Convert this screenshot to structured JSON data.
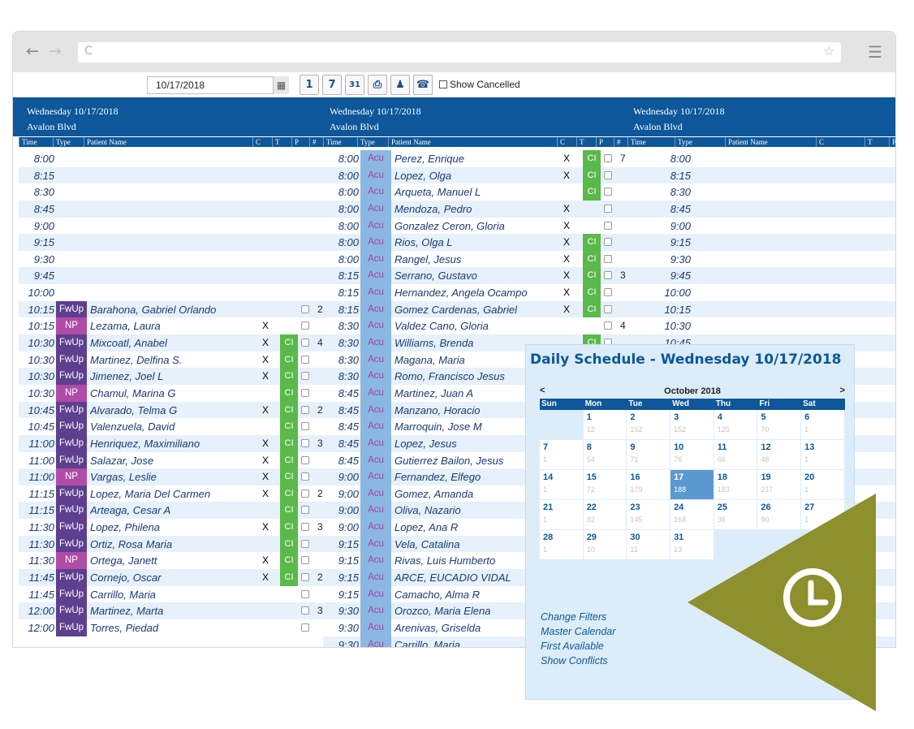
{
  "browser": {
    "back_icon": "←",
    "forward_icon": "→",
    "reload_icon": "C",
    "star_icon": "☆",
    "menu_icon": "☰"
  },
  "toolbar": {
    "date_value": "10/17/2018",
    "calendar_icon": "▦",
    "buttons": [
      {
        "name": "day-view-icon",
        "glyph": "1"
      },
      {
        "name": "week-view-icon",
        "glyph": "7"
      },
      {
        "name": "month-view-icon",
        "glyph": "31"
      },
      {
        "name": "print-icon",
        "glyph": "⎙"
      },
      {
        "name": "person-icon",
        "glyph": "♟"
      },
      {
        "name": "phone-icon",
        "glyph": "☎"
      }
    ],
    "show_cancelled_label": "Show Cancelled"
  },
  "columns": [
    {
      "day": "Wednesday 10/17/2018",
      "location": "Avalon Blvd",
      "headers": [
        "Time",
        "Type",
        "Patient Name",
        "C",
        "T",
        "P",
        "#"
      ]
    },
    {
      "day": "Wednesday 10/17/2018",
      "location": "Avalon Blvd",
      "headers": [
        "Time",
        "Type",
        "Patient Name",
        "C",
        "T",
        "P",
        "#"
      ]
    },
    {
      "day": "Wednesday 10/17/2018",
      "location": "Avalon Blvd",
      "headers": [
        "Time",
        "Type",
        "Patient Name",
        "C",
        "T",
        "P"
      ]
    }
  ],
  "schedule1": [
    {
      "time": "8:00",
      "type": "",
      "name": "",
      "c": "",
      "t": "",
      "p": false,
      "num": ""
    },
    {
      "time": "8:15",
      "type": "",
      "name": "",
      "c": "",
      "t": "",
      "p": false,
      "num": ""
    },
    {
      "time": "8:30",
      "type": "",
      "name": "",
      "c": "",
      "t": "",
      "p": false,
      "num": ""
    },
    {
      "time": "8:45",
      "type": "",
      "name": "",
      "c": "",
      "t": "",
      "p": false,
      "num": ""
    },
    {
      "time": "9:00",
      "type": "",
      "name": "",
      "c": "",
      "t": "",
      "p": false,
      "num": ""
    },
    {
      "time": "9:15",
      "type": "",
      "name": "",
      "c": "",
      "t": "",
      "p": false,
      "num": ""
    },
    {
      "time": "9:30",
      "type": "",
      "name": "",
      "c": "",
      "t": "",
      "p": false,
      "num": ""
    },
    {
      "time": "9:45",
      "type": "",
      "name": "",
      "c": "",
      "t": "",
      "p": false,
      "num": ""
    },
    {
      "time": "10:00",
      "type": "",
      "name": "",
      "c": "",
      "t": "",
      "p": false,
      "num": ""
    },
    {
      "time": "10:15",
      "type": "FwUp",
      "name": "Barahona, Gabriel Orlando",
      "c": "",
      "t": "",
      "p": true,
      "num": "2"
    },
    {
      "time": "10:15",
      "type": "NP",
      "name": "Lezama, Laura",
      "c": "X",
      "t": "",
      "p": true,
      "num": ""
    },
    {
      "time": "10:30",
      "type": "FwUp",
      "name": "Mixcoatl, Anabel",
      "c": "X",
      "t": "CI",
      "p": true,
      "num": "4"
    },
    {
      "time": "10:30",
      "type": "FwUp",
      "name": "Martinez, Delfina S.",
      "c": "X",
      "t": "CI",
      "p": true,
      "num": ""
    },
    {
      "time": "10:30",
      "type": "FwUp",
      "name": "Jimenez, Joel L",
      "c": "X",
      "t": "CI",
      "p": true,
      "num": ""
    },
    {
      "time": "10:30",
      "type": "NP",
      "name": "Chamul, Marina G",
      "c": "",
      "t": "CI",
      "p": true,
      "num": ""
    },
    {
      "time": "10:45",
      "type": "FwUp",
      "name": "Alvarado, Telma G",
      "c": "X",
      "t": "CI",
      "p": true,
      "num": "2"
    },
    {
      "time": "10:45",
      "type": "FwUp",
      "name": "Valenzuela, David",
      "c": "",
      "t": "CI",
      "p": true,
      "num": ""
    },
    {
      "time": "11:00",
      "type": "FwUp",
      "name": "Henriquez, Maximiliano",
      "c": "X",
      "t": "CI",
      "p": true,
      "num": "3"
    },
    {
      "time": "11:00",
      "type": "FwUp",
      "name": "Salazar, Jose",
      "c": "X",
      "t": "CI",
      "p": true,
      "num": ""
    },
    {
      "time": "11:00",
      "type": "NP",
      "name": "Vargas, Leslie",
      "c": "X",
      "t": "CI",
      "p": true,
      "num": ""
    },
    {
      "time": "11:15",
      "type": "FwUp",
      "name": "Lopez, Maria Del Carmen",
      "c": "X",
      "t": "CI",
      "p": true,
      "num": "2"
    },
    {
      "time": "11:15",
      "type": "FwUp",
      "name": "Arteaga, Cesar A",
      "c": "",
      "t": "CI",
      "p": true,
      "num": ""
    },
    {
      "time": "11:30",
      "type": "FwUp",
      "name": "Lopez, Philena",
      "c": "X",
      "t": "CI",
      "p": true,
      "num": "3"
    },
    {
      "time": "11:30",
      "type": "FwUp",
      "name": "Ortiz, Rosa Maria",
      "c": "",
      "t": "CI",
      "p": true,
      "num": ""
    },
    {
      "time": "11:30",
      "type": "NP",
      "name": "Ortega, Janett",
      "c": "X",
      "t": "CI",
      "p": true,
      "num": ""
    },
    {
      "time": "11:45",
      "type": "FwUp",
      "name": "Cornejo, Oscar",
      "c": "X",
      "t": "CI",
      "p": true,
      "num": "2"
    },
    {
      "time": "11:45",
      "type": "FwUp",
      "name": "Carrillo, Maria",
      "c": "",
      "t": "",
      "p": true,
      "num": ""
    },
    {
      "time": "12:00",
      "type": "FwUp",
      "name": "Martinez, Marta",
      "c": "",
      "t": "",
      "p": true,
      "num": "3"
    },
    {
      "time": "12:00",
      "type": "FwUp",
      "name": "Torres, Piedad",
      "c": "",
      "t": "",
      "p": true,
      "num": ""
    }
  ],
  "schedule2": [
    {
      "time": "8:00",
      "type": "Acu",
      "name": "Perez, Enrique",
      "c": "X",
      "t": "CI",
      "p": true,
      "num": "7"
    },
    {
      "time": "8:00",
      "type": "Acu",
      "name": "Lopez, Olga",
      "c": "X",
      "t": "CI",
      "p": true,
      "num": ""
    },
    {
      "time": "8:00",
      "type": "Acu",
      "name": "Arqueta, Manuel L",
      "c": "",
      "t": "CI",
      "p": true,
      "num": ""
    },
    {
      "time": "8:00",
      "type": "Acu",
      "name": "Mendoza, Pedro",
      "c": "X",
      "t": "",
      "p": true,
      "num": ""
    },
    {
      "time": "8:00",
      "type": "Acu",
      "name": "Gonzalez Ceron, Gloria",
      "c": "X",
      "t": "",
      "p": true,
      "num": ""
    },
    {
      "time": "8:00",
      "type": "Acu",
      "name": "Rios, Olga L",
      "c": "X",
      "t": "CI",
      "p": true,
      "num": ""
    },
    {
      "time": "8:00",
      "type": "Acu",
      "name": "Rangel, Jesus",
      "c": "X",
      "t": "CI",
      "p": true,
      "num": ""
    },
    {
      "time": "8:15",
      "type": "Acu",
      "name": "Serrano, Gustavo",
      "c": "X",
      "t": "CI",
      "p": true,
      "num": "3"
    },
    {
      "time": "8:15",
      "type": "Acu",
      "name": "Hernandez, Angela Ocampo",
      "c": "X",
      "t": "CI",
      "p": true,
      "num": ""
    },
    {
      "time": "8:15",
      "type": "Acu",
      "name": "Gomez Cardenas, Gabriel",
      "c": "X",
      "t": "CI",
      "p": true,
      "num": ""
    },
    {
      "time": "8:30",
      "type": "Acu",
      "name": "Valdez Cano, Gloria",
      "c": "",
      "t": "",
      "p": true,
      "num": "4"
    },
    {
      "time": "8:30",
      "type": "Acu",
      "name": "Williams, Brenda",
      "c": "",
      "t": "CI",
      "p": true,
      "num": ""
    },
    {
      "time": "8:30",
      "type": "Acu",
      "name": "Magana, Maria",
      "c": "",
      "t": "",
      "p": false,
      "num": ""
    },
    {
      "time": "8:30",
      "type": "Acu",
      "name": "Romo, Francisco Jesus",
      "c": "",
      "t": "",
      "p": false,
      "num": ""
    },
    {
      "time": "8:45",
      "type": "Acu",
      "name": "Martinez, Juan A",
      "c": "",
      "t": "",
      "p": false,
      "num": ""
    },
    {
      "time": "8:45",
      "type": "Acu",
      "name": "Manzano, Horacio",
      "c": "",
      "t": "",
      "p": false,
      "num": ""
    },
    {
      "time": "8:45",
      "type": "Acu",
      "name": "Marroquin, Jose M",
      "c": "",
      "t": "",
      "p": false,
      "num": ""
    },
    {
      "time": "8:45",
      "type": "Acu",
      "name": "Lopez, Jesus",
      "c": "",
      "t": "",
      "p": false,
      "num": ""
    },
    {
      "time": "8:45",
      "type": "Acu",
      "name": "Gutierrez Bailon, Jesus",
      "c": "",
      "t": "",
      "p": false,
      "num": ""
    },
    {
      "time": "9:00",
      "type": "Acu",
      "name": "Fernandez, Elfego",
      "c": "",
      "t": "",
      "p": false,
      "num": ""
    },
    {
      "time": "9:00",
      "type": "Acu",
      "name": "Gomez, Amanda",
      "c": "",
      "t": "",
      "p": false,
      "num": ""
    },
    {
      "time": "9:00",
      "type": "Acu",
      "name": "Oliva, Nazario",
      "c": "",
      "t": "",
      "p": false,
      "num": ""
    },
    {
      "time": "9:00",
      "type": "Acu",
      "name": "Lopez, Ana R",
      "c": "",
      "t": "",
      "p": false,
      "num": ""
    },
    {
      "time": "9:15",
      "type": "Acu",
      "name": "Vela, Catalina",
      "c": "",
      "t": "",
      "p": false,
      "num": ""
    },
    {
      "time": "9:15",
      "type": "Acu",
      "name": "Rivas, Luis Humberto",
      "c": "",
      "t": "",
      "p": false,
      "num": ""
    },
    {
      "time": "9:15",
      "type": "Acu",
      "name": "ARCE, EUCADIO VIDAL",
      "c": "",
      "t": "",
      "p": false,
      "num": ""
    },
    {
      "time": "9:15",
      "type": "Acu",
      "name": "Camacho, Alma R",
      "c": "",
      "t": "",
      "p": false,
      "num": ""
    },
    {
      "time": "9:30",
      "type": "Acu",
      "name": "Orozco, Maria Elena",
      "c": "",
      "t": "",
      "p": false,
      "num": ""
    },
    {
      "time": "9:30",
      "type": "Acu",
      "name": "Arenivas, Griselda",
      "c": "",
      "t": "",
      "p": false,
      "num": ""
    },
    {
      "time": "9:30",
      "type": "Acu",
      "name": "Carrillo, Maria",
      "c": "",
      "t": "",
      "p": false,
      "num": ""
    }
  ],
  "schedule3": [
    "8:00",
    "8:15",
    "8:30",
    "8:45",
    "9:00",
    "9:15",
    "9:30",
    "9:45",
    "10:00",
    "10:15",
    "10:30",
    "10:45"
  ],
  "popup": {
    "title": "Daily Schedule - Wednesday 10/17/2018",
    "prev": "<",
    "next": ">",
    "month": "October 2018",
    "dow": [
      "Sun",
      "Mon",
      "Tue",
      "Wed",
      "Thu",
      "Fri",
      "Sat"
    ],
    "days": [
      {
        "d": "",
        "c": ""
      },
      {
        "d": "1",
        "c": "12"
      },
      {
        "d": "2",
        "c": "152"
      },
      {
        "d": "3",
        "c": "152"
      },
      {
        "d": "4",
        "c": "125"
      },
      {
        "d": "5",
        "c": "70"
      },
      {
        "d": "6",
        "c": "1"
      },
      {
        "d": "7",
        "c": "1"
      },
      {
        "d": "8",
        "c": "54"
      },
      {
        "d": "9",
        "c": "71"
      },
      {
        "d": "10",
        "c": "76"
      },
      {
        "d": "11",
        "c": "66"
      },
      {
        "d": "12",
        "c": "48"
      },
      {
        "d": "13",
        "c": "1"
      },
      {
        "d": "14",
        "c": "1"
      },
      {
        "d": "15",
        "c": "72"
      },
      {
        "d": "16",
        "c": "179"
      },
      {
        "d": "17",
        "c": "188",
        "sel": true
      },
      {
        "d": "18",
        "c": "183"
      },
      {
        "d": "19",
        "c": "217"
      },
      {
        "d": "20",
        "c": "1"
      },
      {
        "d": "21",
        "c": "1"
      },
      {
        "d": "22",
        "c": "92"
      },
      {
        "d": "23",
        "c": "145"
      },
      {
        "d": "24",
        "c": "168"
      },
      {
        "d": "25",
        "c": "36"
      },
      {
        "d": "26",
        "c": "90"
      },
      {
        "d": "27",
        "c": "1"
      },
      {
        "d": "28",
        "c": "1"
      },
      {
        "d": "29",
        "c": "10"
      },
      {
        "d": "30",
        "c": "11"
      },
      {
        "d": "31",
        "c": "13"
      }
    ],
    "links": [
      "Change Filters",
      "Master Calendar",
      "First Available",
      "Show Conflicts"
    ]
  },
  "colors": {
    "header_blue": "#0d579a",
    "fwup": "#5e3f8f",
    "np": "#b04ba7",
    "acu": "#8ab8e2",
    "checkin_green": "#5ab94a",
    "triangle_olive": "#8e8f2d"
  },
  "badge": {
    "icon": "clock-icon"
  }
}
